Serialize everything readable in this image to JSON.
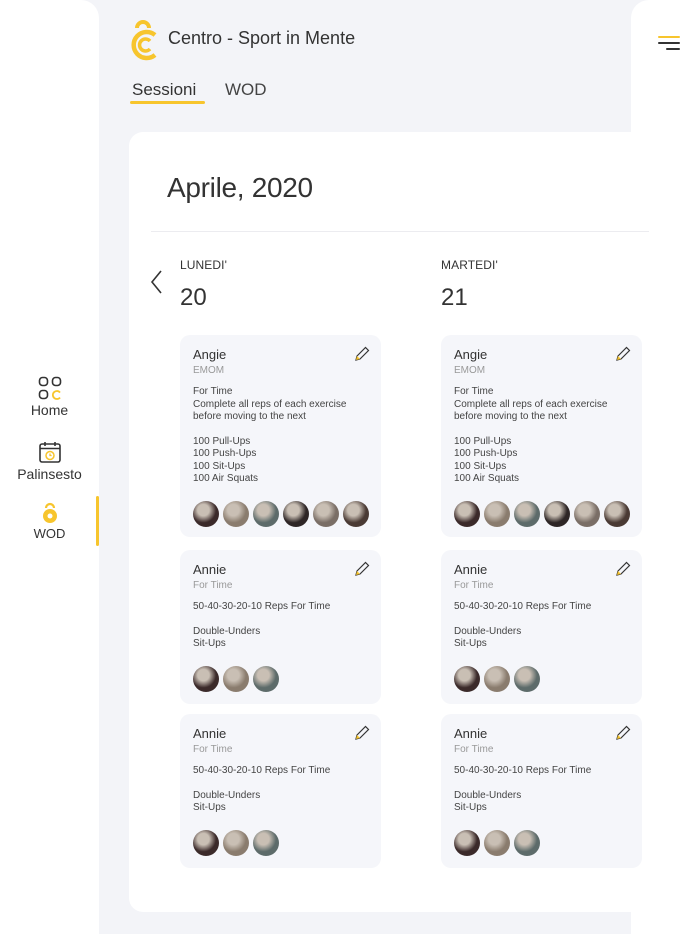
{
  "brand": {
    "title": "Centro - Sport in Mente",
    "accent": "#f7c52d"
  },
  "tabs": [
    {
      "label": "Sessioni",
      "active": true
    },
    {
      "label": "WOD",
      "active": false
    }
  ],
  "sidebar": {
    "items": [
      {
        "label": "Home",
        "icon": "grid-icon"
      },
      {
        "label": "Palinsesto",
        "icon": "calendar-icon"
      },
      {
        "label": "WOD",
        "icon": "kettlebell-icon",
        "active": true
      }
    ]
  },
  "calendar": {
    "month_label": "Aprile, 2020",
    "days": [
      {
        "name": "LUNEDI'",
        "number": "20",
        "sessions": [
          {
            "title": "Angie",
            "type": "EMOM",
            "lines": [
              "For Time",
              "Complete all reps of each exercise",
              "before moving to the next",
              "",
              "100 Pull-Ups",
              "100 Push-Ups",
              "100 Sit-Ups",
              "100 Air Squats"
            ],
            "avatars": 6
          },
          {
            "title": "Annie",
            "type": "For Time",
            "lines": [
              "50-40-30-20-10 Reps For Time",
              "",
              "Double-Unders",
              "Sit-Ups"
            ],
            "avatars": 3
          },
          {
            "title": "Annie",
            "type": "For Time",
            "lines": [
              "50-40-30-20-10 Reps For Time",
              "",
              "Double-Unders",
              "Sit-Ups"
            ],
            "avatars": 3
          }
        ]
      },
      {
        "name": "MARTEDI'",
        "number": "21",
        "sessions": [
          {
            "title": "Angie",
            "type": "EMOM",
            "lines": [
              "For Time",
              "Complete all reps of each exercise",
              "before moving to the next",
              "",
              "100 Pull-Ups",
              "100 Push-Ups",
              "100 Sit-Ups",
              "100 Air Squats"
            ],
            "avatars": 6
          },
          {
            "title": "Annie",
            "type": "For Time",
            "lines": [
              "50-40-30-20-10 Reps For Time",
              "",
              "Double-Unders",
              "Sit-Ups"
            ],
            "avatars": 3
          },
          {
            "title": "Annie",
            "type": "For Time",
            "lines": [
              "50-40-30-20-10 Reps For Time",
              "",
              "Double-Unders",
              "Sit-Ups"
            ],
            "avatars": 3
          }
        ]
      }
    ]
  }
}
